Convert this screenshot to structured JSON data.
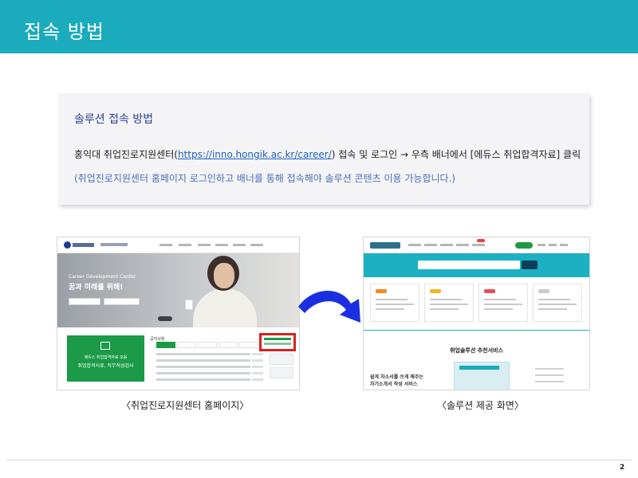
{
  "header": {
    "title": "접속 방법",
    "color": "#1aabbd"
  },
  "info": {
    "heading": "솔루션 접속 방법",
    "line1_prefix": "홍익대 취업진로지원센터(",
    "line1_link": "https://inno.hongik.ac.kr/career/",
    "line1_suffix": ") 접속 및 로그인 → 우측 배너에서 [에듀스 취업합격자료] 클릭",
    "line2": "(취업진로지원센터 홈페이지 로그인하고 배너를 통해 접속해야 솔루션 콘텐츠 이용 가능합니다.)"
  },
  "left_screenshot": {
    "hero_subtitle": "Career Development Center",
    "hero_title": "꿈과 미래를 위해!",
    "green_banner_line1": "에듀스 취업합격자료 모음",
    "green_banner_line2": "취업합격서류, 직무적성검사",
    "notice_title": "공지사항",
    "highlight_color": "#d8221f"
  },
  "right_screenshot": {
    "section_title": "취업솔루션 추천서비스",
    "promo_line1": "쉽게 자소서를 쓰게 해주는",
    "promo_line2": "자기소개서 작성 서비스",
    "banner_color": "#1cb0c2"
  },
  "captions": {
    "left": "〈취업진로지원센터 홈페이지〉",
    "right": "〈솔루션 제공 화면〉"
  },
  "arrow_color": "#1a2fe0",
  "page_number": "2"
}
